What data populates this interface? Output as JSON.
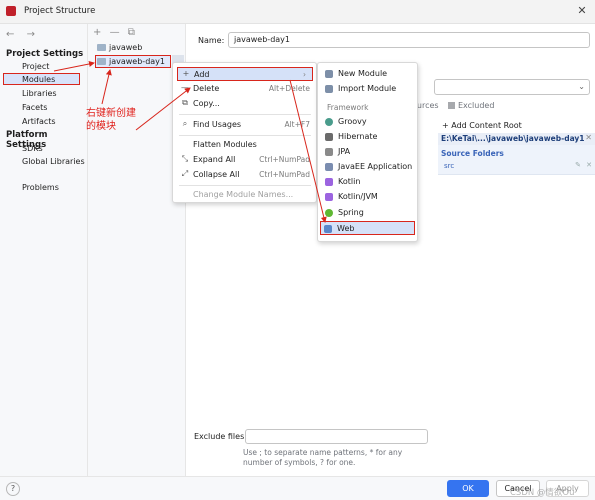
{
  "window": {
    "title": "Project Structure",
    "close_icon": "close-icon"
  },
  "left_nav": {
    "back_arrow": "←",
    "forward_arrow": "→",
    "project_settings_header": "Project Settings",
    "project_settings_items": [
      "Project",
      "Modules",
      "Libraries",
      "Facets",
      "Artifacts"
    ],
    "platform_settings_header": "Platform Settings",
    "platform_settings_items": [
      "SDKs",
      "Global Libraries"
    ],
    "other_items": [
      "Problems"
    ],
    "selected": "Modules"
  },
  "module_tree": {
    "toolbar": {
      "add": "+",
      "remove": "—",
      "copy": "⧉"
    },
    "items": [
      "javaweb",
      "javaweb-day1"
    ],
    "selected": "javaweb-day1"
  },
  "module_editor": {
    "name_label": "Name:",
    "name_value": "javaweb-day1",
    "tabs_partial": "ources",
    "excluded_label": "Excluded",
    "add_content_root": "Add Content Root",
    "content_root_path": "E:\\KeTai\\...\\javaweb\\javaweb-day1",
    "source_folders_title": "Source Folders",
    "source_folder_item": "src",
    "exclude_files_label": "Exclude files:",
    "exclude_files_value": "",
    "hint": "Use ; to separate name patterns, * for any number of symbols, ? for one."
  },
  "context_menu": {
    "items": [
      {
        "icon": "+",
        "label": "Add",
        "shortcut": "›"
      },
      {
        "icon": "—",
        "label": "Delete",
        "shortcut": "Alt+Delete"
      },
      {
        "icon": "⧉",
        "label": "Copy...",
        "shortcut": ""
      },
      {
        "icon": "⌕",
        "label": "Find Usages",
        "shortcut": "Alt+F7"
      },
      {
        "icon": "",
        "label": "Flatten Modules",
        "shortcut": ""
      },
      {
        "icon": "⤡",
        "label": "Expand All",
        "shortcut": "Ctrl+NumPad"
      },
      {
        "icon": "⤢",
        "label": "Collapse All",
        "shortcut": "Ctrl+NumPad"
      },
      {
        "icon": "",
        "label": "Change Module Names...",
        "shortcut": ""
      }
    ],
    "disabled_item": "Change Module Names..."
  },
  "submenu": {
    "top_items": [
      {
        "label": "New Module",
        "icon": "new-module-icon",
        "color": "#7d8fa8"
      },
      {
        "label": "Import Module",
        "icon": "import-module-icon",
        "color": "#7d8fa8"
      }
    ],
    "group_label": "Framework",
    "framework_items": [
      {
        "label": "Groovy",
        "icon": "groovy-icon",
        "color": "#4a9c8c"
      },
      {
        "label": "Hibernate",
        "icon": "hibernate-icon",
        "color": "#6b6b6b"
      },
      {
        "label": "JPA",
        "icon": "jpa-icon",
        "color": "#8a8a8a"
      },
      {
        "label": "JavaEE Application",
        "icon": "javaee-icon",
        "color": "#7b8db0"
      },
      {
        "label": "Kotlin",
        "icon": "kotlin-icon",
        "color": "#9c64e0"
      },
      {
        "label": "Kotlin/JVM",
        "icon": "kotlin-jvm-icon",
        "color": "#9c64e0"
      },
      {
        "label": "Spring",
        "icon": "spring-icon",
        "color": "#5fb832"
      },
      {
        "label": "Web",
        "icon": "web-icon",
        "color": "#5a86c8"
      }
    ],
    "selected": "Web"
  },
  "annotation": {
    "line1": "右键新创建",
    "line2": "的模块",
    "color": "#e0201b"
  },
  "buttons": {
    "help": "?",
    "ok": "OK",
    "cancel": "Cancel",
    "apply": "Apply"
  },
  "watermark": "CSDN @情欲Ou",
  "colors": {
    "accent": "#3574f0",
    "selection": "#d5e1f8",
    "annotation_red": "#d8261c"
  }
}
